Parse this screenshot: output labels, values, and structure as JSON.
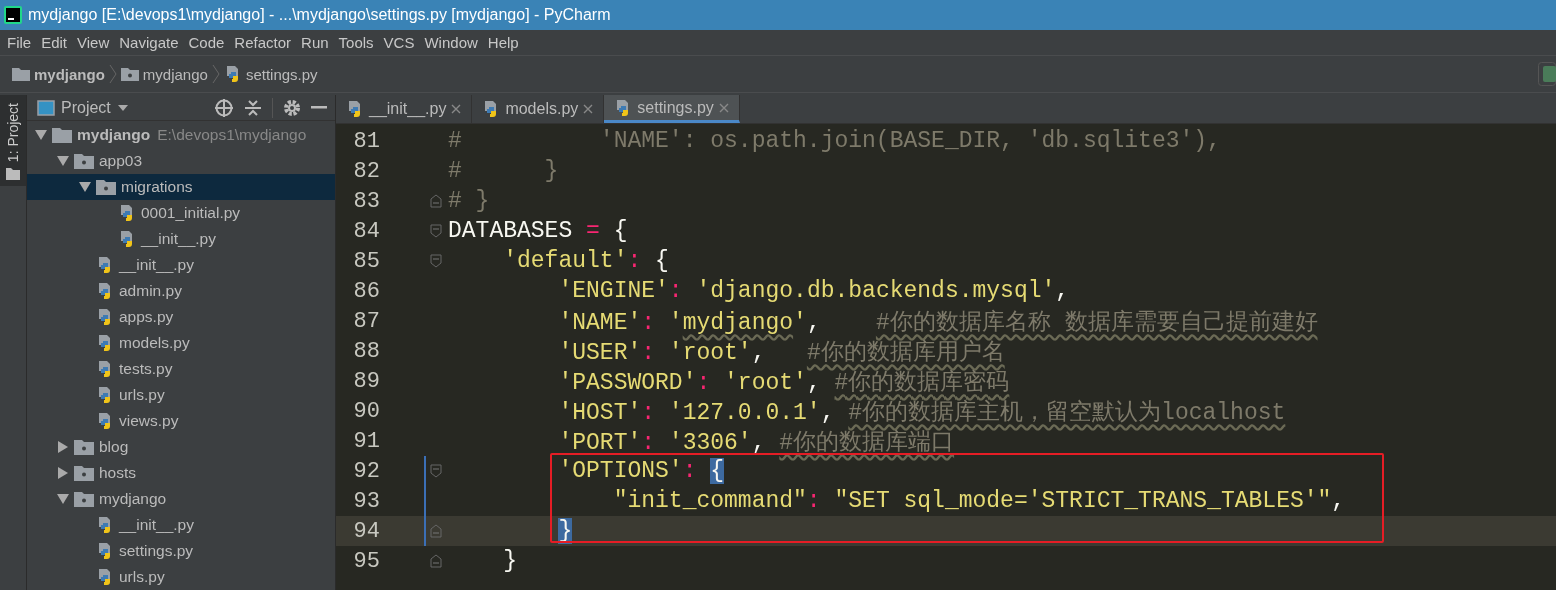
{
  "window": {
    "title": "mydjango [E:\\devops1\\mydjango] - ...\\mydjango\\settings.py [mydjango] - PyCharm"
  },
  "menu": [
    "File",
    "Edit",
    "View",
    "Navigate",
    "Code",
    "Refactor",
    "Run",
    "Tools",
    "VCS",
    "Window",
    "Help"
  ],
  "breadcrumb": [
    {
      "label": "mydjango",
      "kind": "project"
    },
    {
      "label": "mydjango",
      "kind": "folder"
    },
    {
      "label": "settings.py",
      "kind": "python"
    }
  ],
  "tool_strip": {
    "label": "1: Project"
  },
  "project_panel": {
    "title": "Project",
    "tree": [
      {
        "label": "mydjango",
        "path": "E:\\devops1\\mydjango",
        "kind": "project",
        "expanded": true,
        "selected": false,
        "children": [
          {
            "label": "app03",
            "kind": "folder",
            "expanded": true,
            "selected": false,
            "children": [
              {
                "label": "migrations",
                "kind": "folder",
                "expanded": true,
                "selected": true,
                "children": [
                  {
                    "label": "0001_initial.py",
                    "kind": "python",
                    "selected": false
                  },
                  {
                    "label": "__init__.py",
                    "kind": "python",
                    "selected": false
                  }
                ]
              },
              {
                "label": "__init__.py",
                "kind": "python",
                "selected": false
              },
              {
                "label": "admin.py",
                "kind": "python",
                "selected": false
              },
              {
                "label": "apps.py",
                "kind": "python",
                "selected": false
              },
              {
                "label": "models.py",
                "kind": "python",
                "selected": false
              },
              {
                "label": "tests.py",
                "kind": "python",
                "selected": false
              },
              {
                "label": "urls.py",
                "kind": "python",
                "selected": false
              },
              {
                "label": "views.py",
                "kind": "python",
                "selected": false
              }
            ]
          },
          {
            "label": "blog",
            "kind": "folder",
            "expanded": false,
            "selected": false
          },
          {
            "label": "hosts",
            "kind": "folder",
            "expanded": false,
            "selected": false
          },
          {
            "label": "mydjango",
            "kind": "folder",
            "expanded": true,
            "selected": false,
            "children": [
              {
                "label": "__init__.py",
                "kind": "python",
                "selected": false
              },
              {
                "label": "settings.py",
                "kind": "python",
                "selected": false
              },
              {
                "label": "urls.py",
                "kind": "python",
                "selected": false
              }
            ]
          }
        ]
      }
    ]
  },
  "tabs": [
    {
      "label": "__init__.py",
      "selected": false
    },
    {
      "label": "models.py",
      "selected": false
    },
    {
      "label": "settings.py",
      "selected": true
    }
  ],
  "editor": {
    "lines": [
      {
        "number": "81",
        "fold_open": false,
        "fold_close": false,
        "current": false,
        "modified": false,
        "tokens": [
          {
            "kind": "comment",
            "text": "#          'NAME': os.path.join(BASE_DIR, 'db.sqlite3'),"
          }
        ]
      },
      {
        "number": "82",
        "fold_open": false,
        "fold_close": false,
        "current": false,
        "modified": false,
        "tokens": [
          {
            "kind": "comment",
            "text": "#      }"
          }
        ]
      },
      {
        "number": "83",
        "fold_open": false,
        "fold_close": true,
        "current": false,
        "modified": false,
        "tokens": [
          {
            "kind": "comment",
            "text": "# }"
          }
        ]
      },
      {
        "number": "84",
        "fold_open": true,
        "fold_close": false,
        "current": false,
        "modified": false,
        "tokens": [
          {
            "kind": "plain",
            "text": "DATABASES "
          },
          {
            "kind": "op",
            "text": "="
          },
          {
            "kind": "plain",
            "text": " {"
          }
        ]
      },
      {
        "number": "85",
        "fold_open": true,
        "fold_close": false,
        "current": false,
        "modified": false,
        "tokens": [
          {
            "kind": "string",
            "text": "    'default'"
          },
          {
            "kind": "op",
            "text": ":"
          },
          {
            "kind": "plain",
            "text": " {"
          }
        ]
      },
      {
        "number": "86",
        "fold_open": false,
        "fold_close": false,
        "current": false,
        "modified": false,
        "tokens": [
          {
            "kind": "string",
            "text": "        'ENGINE'"
          },
          {
            "kind": "op",
            "text": ":"
          },
          {
            "kind": "string",
            "text": " 'django.db.backends.mysql'"
          },
          {
            "kind": "plain",
            "text": ","
          }
        ]
      },
      {
        "number": "87",
        "fold_open": false,
        "fold_close": false,
        "current": false,
        "modified": false,
        "tokens": [
          {
            "kind": "string",
            "text": "        'NAME'",
            "spell_warning": false
          },
          {
            "kind": "op",
            "text": ":",
            "spell_warning": false
          },
          {
            "kind": "string",
            "text": " '",
            "spell_warning": false
          },
          {
            "kind": "string",
            "text": "mydjango",
            "spell_warning": true
          },
          {
            "kind": "string",
            "text": "'",
            "spell_warning": false
          },
          {
            "kind": "plain",
            "text": ",    ",
            "spell_warning": false
          },
          {
            "kind": "comment",
            "text": "#你的数据库名称 数据库需要自己提前建好",
            "spell_warning": true
          }
        ]
      },
      {
        "number": "88",
        "fold_open": false,
        "fold_close": false,
        "current": false,
        "modified": false,
        "tokens": [
          {
            "kind": "string",
            "text": "        'USER'",
            "spell_warning": false
          },
          {
            "kind": "op",
            "text": ":",
            "spell_warning": false
          },
          {
            "kind": "string",
            "text": " 'root'",
            "spell_warning": false
          },
          {
            "kind": "plain",
            "text": ",   ",
            "spell_warning": false
          },
          {
            "kind": "comment",
            "text": "#你的数据库用户名",
            "spell_warning": true
          }
        ]
      },
      {
        "number": "89",
        "fold_open": false,
        "fold_close": false,
        "current": false,
        "modified": false,
        "tokens": [
          {
            "kind": "string",
            "text": "        'PASSWORD'",
            "spell_warning": false
          },
          {
            "kind": "op",
            "text": ":",
            "spell_warning": false
          },
          {
            "kind": "string",
            "text": " 'root'",
            "spell_warning": false
          },
          {
            "kind": "plain",
            "text": ", ",
            "spell_warning": false
          },
          {
            "kind": "comment",
            "text": "#你的数据库密码",
            "spell_warning": true
          }
        ]
      },
      {
        "number": "90",
        "fold_open": false,
        "fold_close": false,
        "current": false,
        "modified": false,
        "tokens": [
          {
            "kind": "string",
            "text": "        'HOST'",
            "spell_warning": false
          },
          {
            "kind": "op",
            "text": ":",
            "spell_warning": false
          },
          {
            "kind": "string",
            "text": " '127.0.0.1'",
            "spell_warning": false
          },
          {
            "kind": "plain",
            "text": ", ",
            "spell_warning": false
          },
          {
            "kind": "comment",
            "text": "#你的数据库主机，留空默认为localhost",
            "spell_warning": true
          }
        ]
      },
      {
        "number": "91",
        "fold_open": false,
        "fold_close": false,
        "current": false,
        "modified": false,
        "tokens": [
          {
            "kind": "string",
            "text": "        'PORT'",
            "spell_warning": false
          },
          {
            "kind": "op",
            "text": ":",
            "spell_warning": false
          },
          {
            "kind": "string",
            "text": " '3306'",
            "spell_warning": false
          },
          {
            "kind": "plain",
            "text": ", ",
            "spell_warning": false
          },
          {
            "kind": "comment",
            "text": "#你的数据库端口",
            "spell_warning": true
          }
        ]
      },
      {
        "number": "92",
        "fold_open": true,
        "fold_close": false,
        "current": false,
        "modified": true,
        "tokens": [
          {
            "kind": "string",
            "text": "        'OPTIONS'",
            "brace_match": false
          },
          {
            "kind": "op",
            "text": ": ",
            "brace_match": false
          },
          {
            "kind": "plain",
            "text": "{",
            "brace_match": true
          }
        ]
      },
      {
        "number": "93",
        "fold_open": false,
        "fold_close": false,
        "current": false,
        "modified": true,
        "tokens": [
          {
            "kind": "string",
            "text": "            \"init_command\""
          },
          {
            "kind": "op",
            "text": ":"
          },
          {
            "kind": "string",
            "text": " \"SET sql_mode='STRICT_TRANS_TABLES'\""
          },
          {
            "kind": "plain",
            "text": ","
          }
        ]
      },
      {
        "number": "94",
        "fold_open": false,
        "fold_close": true,
        "current": true,
        "modified": true,
        "tokens": [
          {
            "kind": "plain",
            "text": "        }",
            "brace_match": true
          }
        ]
      },
      {
        "number": "95",
        "fold_open": false,
        "fold_close": true,
        "current": false,
        "modified": false,
        "tokens": [
          {
            "kind": "plain",
            "text": "    }"
          }
        ]
      }
    ]
  }
}
